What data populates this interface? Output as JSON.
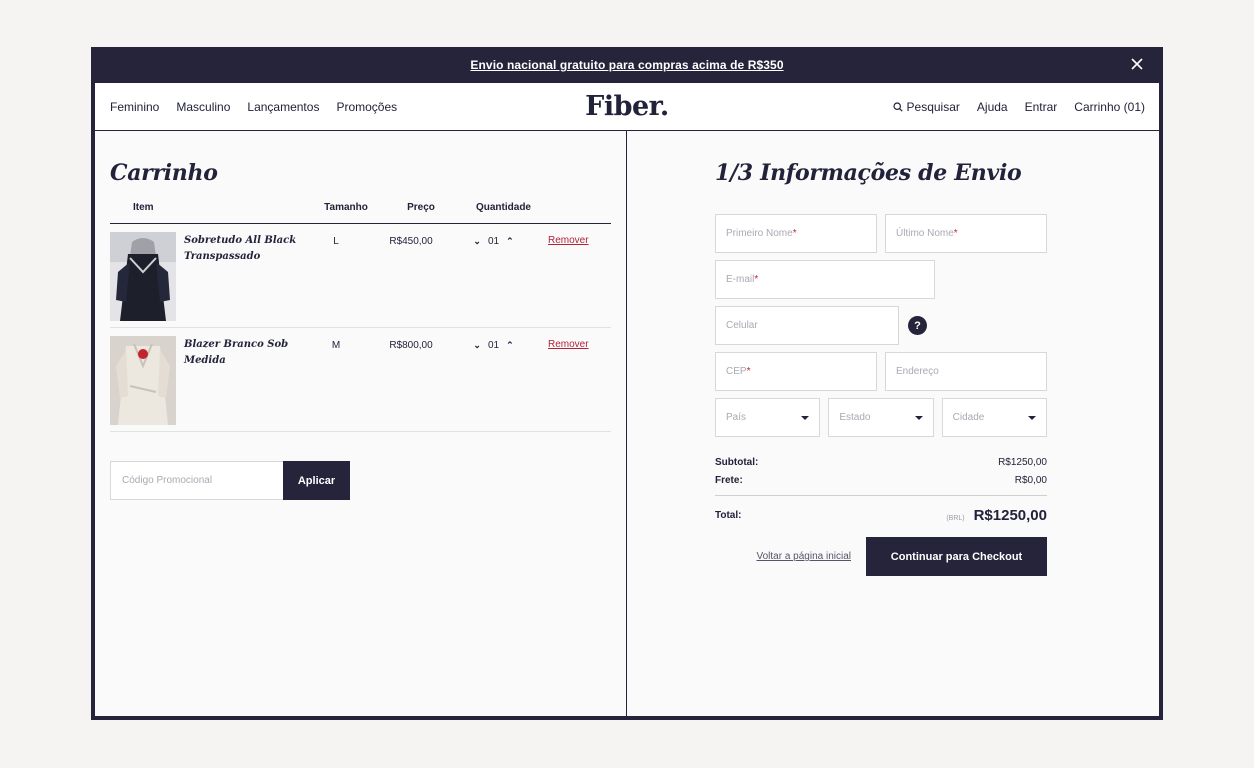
{
  "banner": {
    "text": "Envio nacional gratuito para compras acima de R$350"
  },
  "nav": {
    "left": [
      "Feminino",
      "Masculino",
      "Lançamentos",
      "Promoções"
    ],
    "logo": "Fiber.",
    "search": "Pesquisar",
    "help": "Ajuda",
    "login": "Entrar",
    "cart": "Carrinho (01)"
  },
  "cart": {
    "title": "Carrinho",
    "columns": {
      "item": "Item",
      "size": "Tamanho",
      "price": "Preço",
      "qty": "Quantidade"
    },
    "items": [
      {
        "name": "Sobretudo All Black Transpassado",
        "size": "L",
        "price": "R$450,00",
        "qty": "01",
        "remove": "Remover"
      },
      {
        "name": "Blazer Branco Sob Medida",
        "size": "M",
        "price": "R$800,00",
        "qty": "01",
        "remove": "Remover"
      }
    ],
    "promo": {
      "placeholder": "Código Promocional",
      "apply": "Aplicar"
    }
  },
  "shipping": {
    "title": "1/3 Informações de Envio",
    "fields": {
      "first_name": "Primeiro Nome",
      "last_name": "Último Nome",
      "email": "E-mail",
      "phone": "Celular",
      "help": "?",
      "cep": "CEP",
      "address": "Endereço",
      "country": "País",
      "state": "Estado",
      "city": "Cidade",
      "required_mark": "*"
    },
    "summary": {
      "subtotal_label": "Subtotal:",
      "subtotal": "R$1250,00",
      "shipping_label": "Frete:",
      "shipping": "R$0,00",
      "total_label": "Total:",
      "currency": "(BRL)",
      "total": "R$1250,00"
    },
    "back": "Voltar a página inicial",
    "checkout": "Continuar para Checkout"
  },
  "colors": {
    "navy": "#25243b",
    "accent_red": "#b0243a",
    "bg": "#f5f4f2"
  }
}
